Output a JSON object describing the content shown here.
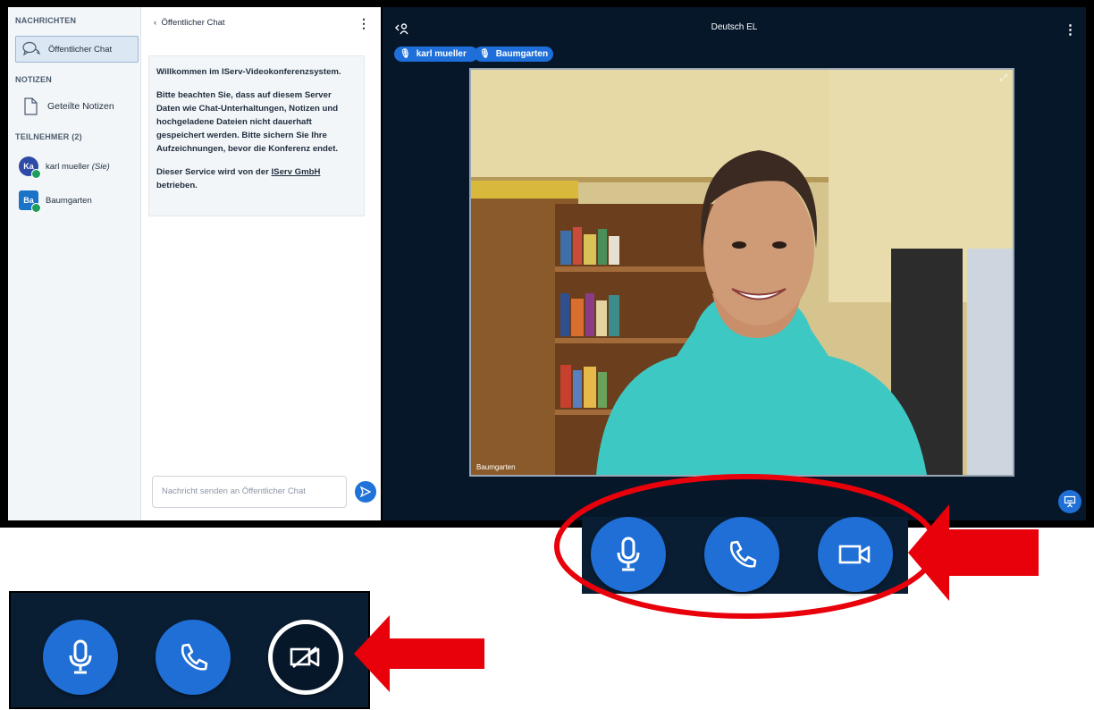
{
  "sidebar": {
    "messages_heading": "NACHRICHTEN",
    "public_chat": "Öffentlicher Chat",
    "notes_heading": "NOTIZEN",
    "shared_notes": "Geteilte Notizen",
    "participants_heading": "TEILNEHMER (2)",
    "participants": [
      {
        "initials": "Ka",
        "name": "karl mueller",
        "suffix": "(Sie)"
      },
      {
        "initials": "Ba",
        "name": "Baumgarten",
        "suffix": ""
      }
    ]
  },
  "chat": {
    "title": "Öffentlicher Chat",
    "welcome_line1": "Willkommen im IServ-Videokonferenzsystem.",
    "welcome_line2": "Bitte beachten Sie, dass auf diesem Server Daten wie Chat-Unterhaltungen, Notizen und hochgeladene Dateien nicht dauerhaft gespeichert werden. Bitte sichern Sie Ihre Aufzeichnungen, bevor die Konferenz endet.",
    "welcome_line3_pre": "Dieser Service wird von der ",
    "welcome_link": "IServ GmbH",
    "welcome_line3_post": " betrieben.",
    "input_placeholder": "Nachricht senden an Öffentlicher Chat"
  },
  "stage": {
    "title": "Deutsch EL",
    "talkers": [
      "karl mueller",
      "Baumgarten"
    ],
    "video_label": "Baumgarten"
  },
  "colors": {
    "accent": "#1f6fd6",
    "stage_bg": "#06172a",
    "annotation_red": "#e8000b"
  },
  "icons": {
    "microphone": "microphone-icon",
    "phone": "phone-icon",
    "camera": "camera-icon",
    "camera_off": "camera-off-icon"
  }
}
